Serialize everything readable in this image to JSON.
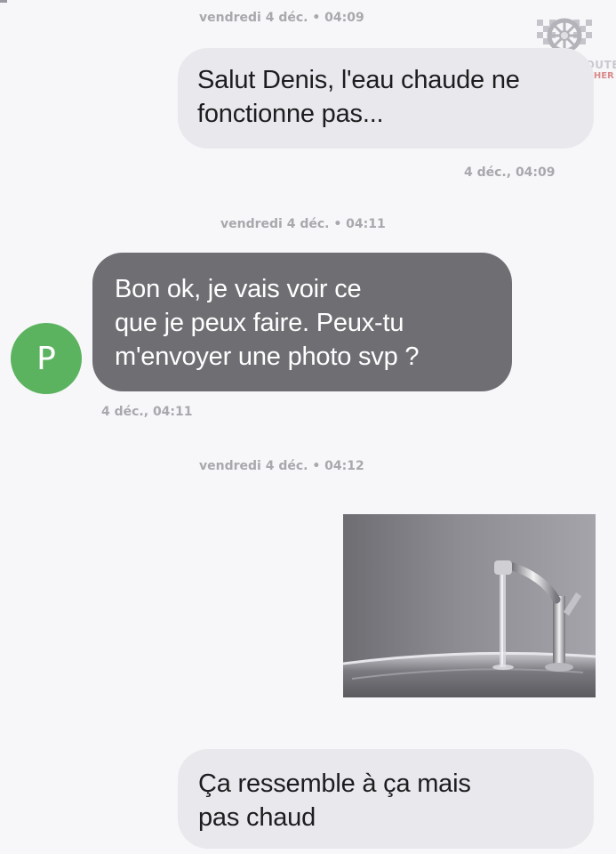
{
  "conversation": {
    "messages": [
      {
        "date_header": "vendredi 4 déc. • 04:09",
        "direction": "outgoing",
        "lines": [
          "Salut Denis, l'eau chaude ne",
          "fonctionne pas..."
        ],
        "time": "4 déc., 04:09"
      },
      {
        "date_header": "vendredi 4 déc. • 04:11",
        "direction": "incoming",
        "sender_initial": "P",
        "lines": [
          "Bon ok, je vais voir ce",
          "que je peux faire. Peux-tu",
          "m'envoyer une photo svp ?"
        ],
        "time": "4 déc., 04:11"
      },
      {
        "date_header": "vendredi 4 déc. • 04:12",
        "direction": "outgoing",
        "attachment": "photo-of-running-tap-over-sink"
      },
      {
        "direction": "outgoing",
        "lines": [
          "Ça ressemble à ça mais",
          "pas chaud"
        ]
      }
    ]
  },
  "watermark": {
    "line1": "DANS LE DOUTE",
    "line2": "PIED AU PLANCHER",
    "icon": "racing-wheel-logo"
  },
  "colors": {
    "background": "#f7f7f9",
    "outgoing_bubble": "#e9e9ed",
    "incoming_bubble": "#6f6e73",
    "avatar": "#5cb35f",
    "meta_text": "#a8a8ad"
  }
}
